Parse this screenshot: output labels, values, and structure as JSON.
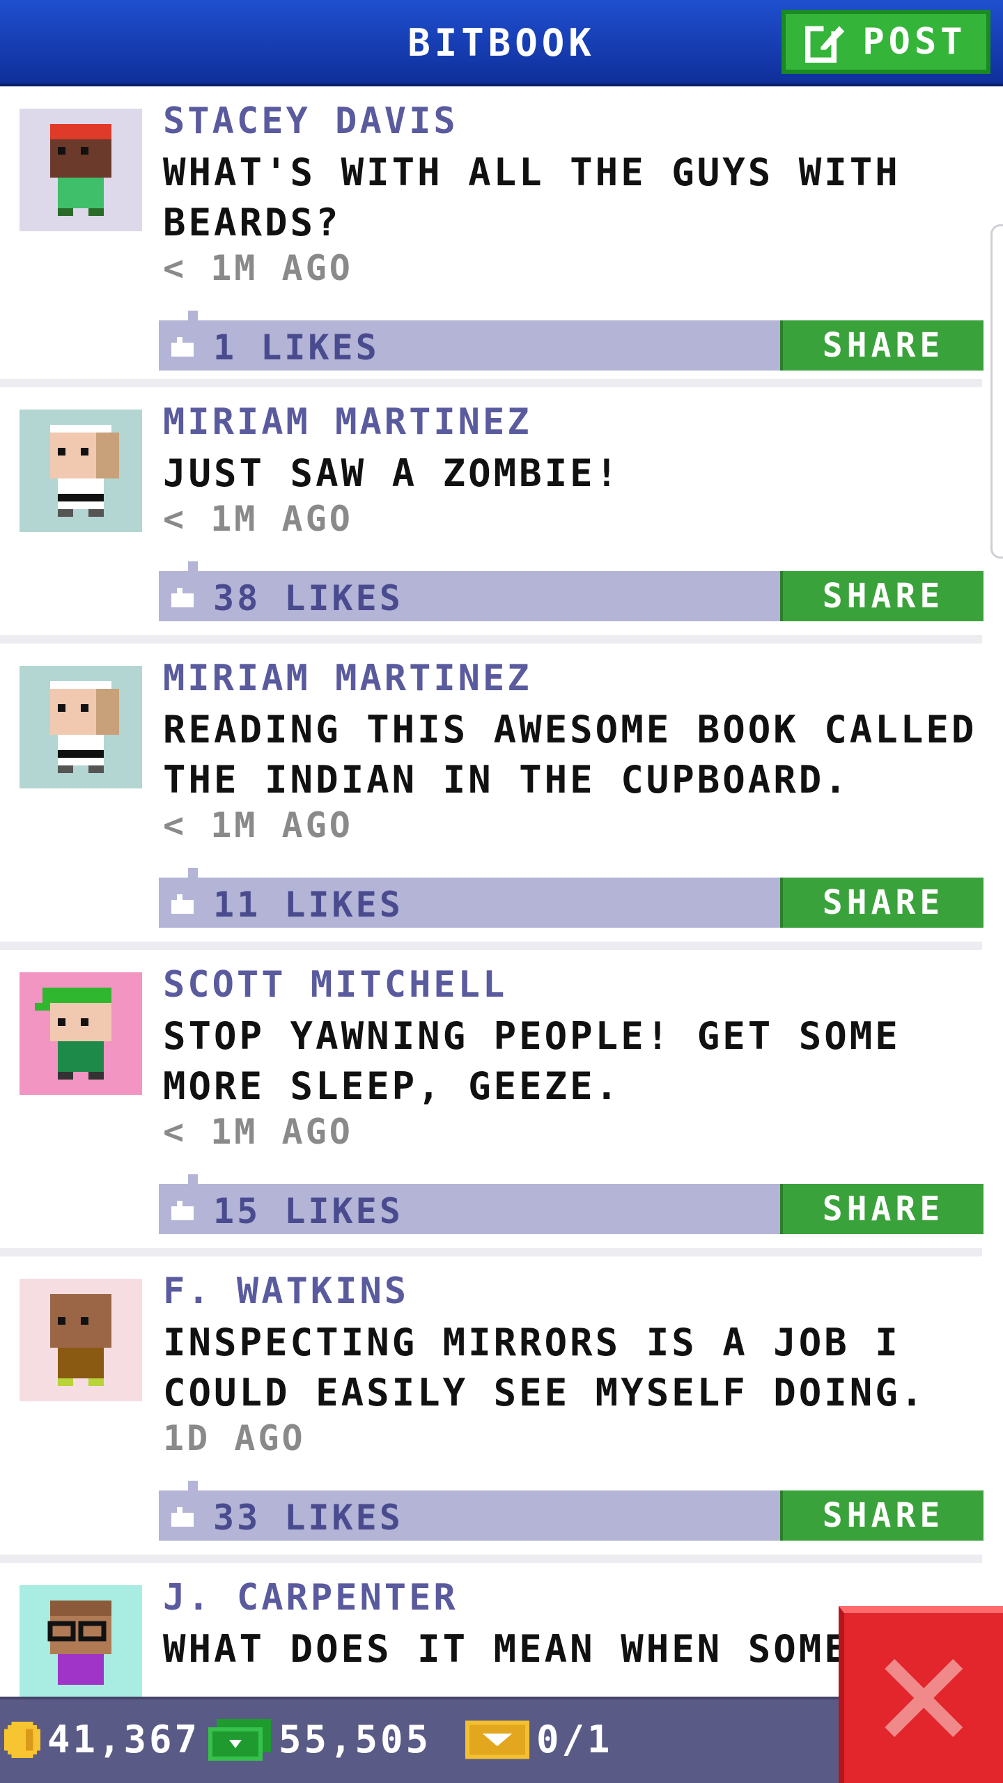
{
  "header": {
    "title": "BITBOOK",
    "post_label": "POST"
  },
  "posts": [
    {
      "author": "STACEY DAVIS",
      "message": "WHAT'S WITH ALL THE GUYS WITH BEARDS?",
      "time": "< 1M AGO",
      "likes": "1 LIKES",
      "share": "SHARE",
      "avatar_bg": "#ddd8ea"
    },
    {
      "author": "MIRIAM MARTINEZ",
      "message": "JUST SAW A ZOMBIE!",
      "time": "< 1M AGO",
      "likes": "38 LIKES",
      "share": "SHARE",
      "avatar_bg": "#b3d6d2"
    },
    {
      "author": "MIRIAM MARTINEZ",
      "message": "READING THIS AWESOME BOOK CALLED THE INDIAN IN THE CUPBOARD.",
      "time": "< 1M AGO",
      "likes": "11 LIKES",
      "share": "SHARE",
      "avatar_bg": "#b3d6d2"
    },
    {
      "author": "SCOTT MITCHELL",
      "message": "STOP YAWNING PEOPLE! GET SOME MORE SLEEP, GEEZE.",
      "time": "< 1M AGO",
      "likes": "15 LIKES",
      "share": "SHARE",
      "avatar_bg": "#f295c2"
    },
    {
      "author": "F. WATKINS",
      "message": "INSPECTING MIRRORS IS A JOB I COULD EASILY SEE MYSELF DOING.",
      "time": "1D AGO",
      "likes": "33 LIKES",
      "share": "SHARE",
      "avatar_bg": "#f5dde2"
    },
    {
      "author": "J. CARPENTER",
      "message": "WHAT DOES IT MEAN WHEN SOME",
      "avatar_bg": "#a8ece2"
    }
  ],
  "bottom_bar": {
    "coins": "41,367",
    "bux": "55,505",
    "tickets": "0/1"
  },
  "colors": {
    "header": "#1f4fcf",
    "share": "#3aa23a",
    "likes_bar": "#b3b4d6",
    "author": "#5a5a9e",
    "close": "#e3262c"
  },
  "icons": [
    "edit-icon",
    "like-icon",
    "coin-icon",
    "bux-icon",
    "ticket-icon",
    "close-icon"
  ]
}
